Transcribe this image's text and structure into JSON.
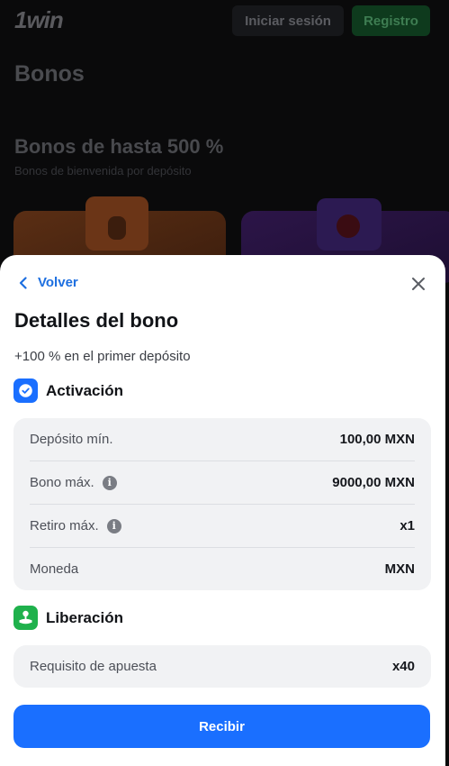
{
  "background": {
    "logo": "1win",
    "login_label": "Iniciar sesión",
    "register_label": "Registro",
    "page_title": "Bonos",
    "section_title": "Bonos de hasta 500 %",
    "section_subtitle": "Bonos de bienvenida por depósito"
  },
  "sheet": {
    "back_label": "Volver",
    "title": "Detalles del bono",
    "subtitle": "+100 % en el primer depósito",
    "activation": {
      "heading": "Activación",
      "rows": [
        {
          "label": "Depósito mín.",
          "value": "100,00 MXN",
          "info": false
        },
        {
          "label": "Bono máx.",
          "value": "9000,00 MXN",
          "info": true
        },
        {
          "label": "Retiro máx.",
          "value": "x1",
          "info": true
        },
        {
          "label": "Moneda",
          "value": "MXN",
          "info": false
        }
      ]
    },
    "release": {
      "heading": "Liberación",
      "rows": [
        {
          "label": "Requisito de apuesta",
          "value": "x40"
        }
      ]
    },
    "cta_label": "Recibir"
  },
  "colors": {
    "accent": "#1a6fff",
    "activation_icon": "#1a6fff",
    "release_icon": "#1fb14c",
    "register_bg": "#0e3a1d"
  },
  "icons": {
    "back": "chevron-left-icon",
    "close": "close-icon",
    "activation": "check-badge-icon",
    "release": "joystick-icon",
    "info": "info-icon"
  }
}
